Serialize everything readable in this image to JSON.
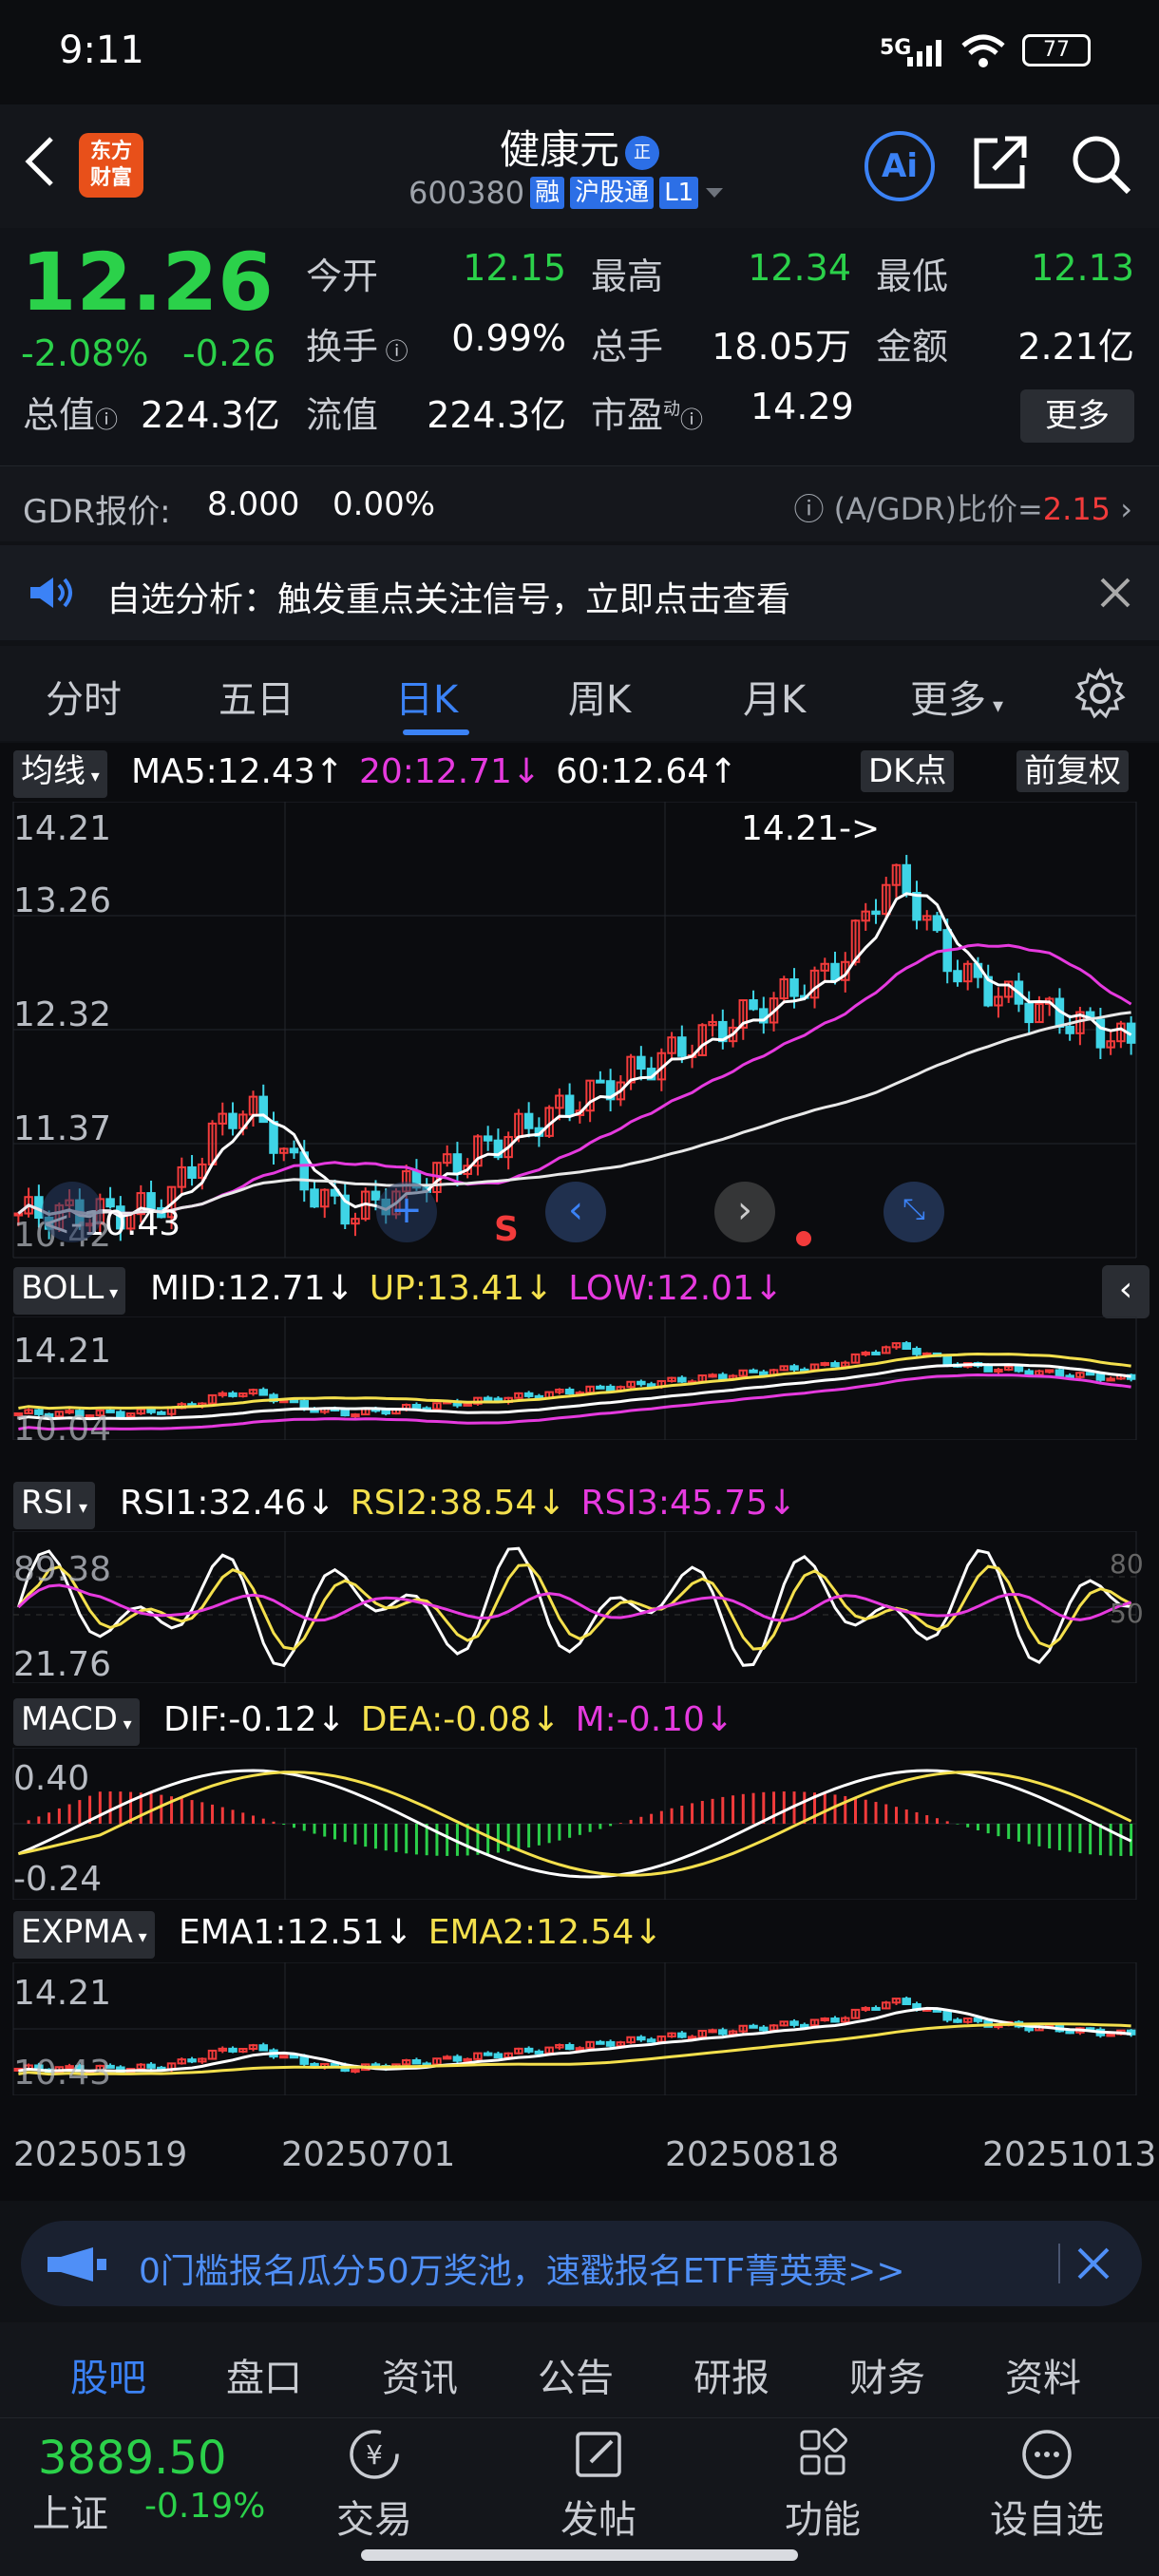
{
  "status_bar": {
    "time": "9:11",
    "signal": "5G",
    "battery": "77"
  },
  "header": {
    "logo_text": [
      "东方",
      "财富"
    ],
    "title": "健康元",
    "title_badge": "正",
    "code": "600380",
    "tags": [
      "融",
      "沪股通",
      "L1"
    ],
    "ai_label": "Ai"
  },
  "quote": {
    "price": "12.26",
    "change_pct": "-2.08%",
    "change_val": "-0.26",
    "fields": [
      {
        "label": "今开",
        "value": "12.15",
        "color": "#2bd14a"
      },
      {
        "label": "最高",
        "value": "12.34",
        "color": "#2bd14a"
      },
      {
        "label": "最低",
        "value": "12.13",
        "color": "#2bd14a"
      },
      {
        "label": "换手",
        "value": "0.99%",
        "color": "#ffffff"
      },
      {
        "label": "总手",
        "value": "18.05万",
        "color": "#ffffff"
      },
      {
        "label": "金额",
        "value": "2.21亿",
        "color": "#ffffff"
      },
      {
        "label": "总值",
        "value": "224.3亿",
        "color": "#ffffff"
      },
      {
        "label": "流值",
        "value": "224.3亿",
        "color": "#ffffff"
      },
      {
        "label": "市盈",
        "value": "14.29",
        "color": "#ffffff"
      }
    ],
    "pe_superscript": "动",
    "more_label": "更多"
  },
  "gdr": {
    "label": "GDR报价:",
    "price": "8.000",
    "pct": "0.00%",
    "ratio_label": "(A/GDR)比价=",
    "ratio": "2.15"
  },
  "notice": {
    "text": "自选分析：触发重点关注信号，立即点击查看"
  },
  "tabs": [
    "分时",
    "五日",
    "日K",
    "周K",
    "月K",
    "更多"
  ],
  "chart": {
    "ma_chip": "均线",
    "ma": [
      {
        "text": "MA5:12.43↑",
        "color": "#ffffff"
      },
      {
        "text": "20:12.71↓",
        "color": "#e63adf"
      },
      {
        "text": "60:12.64↑",
        "color": "#ffffff"
      }
    ],
    "dk_chip": "DK点",
    "adj_chip": "前复权",
    "main_axis": [
      "14.21",
      "13.26",
      "12.32",
      "11.37",
      "10.42"
    ],
    "high_marker": "14.21->",
    "low_marker": "<-10.43",
    "sell_marker": "S",
    "boll_chip": "BOLL",
    "boll": [
      {
        "text": "MID:12.71↓",
        "color": "#ffffff"
      },
      {
        "text": "UP:13.41↓",
        "color": "#f4e04d"
      },
      {
        "text": "LOW:12.01↓",
        "color": "#e63adf"
      }
    ],
    "boll_axis": [
      "14.21",
      "10.04"
    ],
    "rsi_chip": "RSI",
    "rsi": [
      {
        "text": "RSI1:32.46↓",
        "color": "#ffffff"
      },
      {
        "text": "RSI2:38.54↓",
        "color": "#f4e04d"
      },
      {
        "text": "RSI3:45.75↓",
        "color": "#e63adf"
      }
    ],
    "rsi_axis": [
      "89.38",
      "21.76"
    ],
    "rsi_ref": [
      "80",
      "50"
    ],
    "macd_chip": "MACD",
    "macd": [
      {
        "text": "DIF:-0.12↓",
        "color": "#ffffff"
      },
      {
        "text": "DEA:-0.08↓",
        "color": "#f4e04d"
      },
      {
        "text": "M:-0.10↓",
        "color": "#e63adf"
      }
    ],
    "macd_axis": [
      "0.40",
      "-0.24"
    ],
    "expma_chip": "EXPMA",
    "expma": [
      {
        "text": "EMA1:12.51↓",
        "color": "#ffffff"
      },
      {
        "text": "EMA2:12.54↓",
        "color": "#f4e04d"
      }
    ],
    "expma_axis": [
      "14.21",
      "10.43"
    ],
    "dates": [
      "20250519",
      "20250701",
      "20250818",
      "20251013"
    ]
  },
  "promo": {
    "text": "0门槛报名瓜分50万奖池，速戳报名ETF菁英赛>>"
  },
  "bottom_tabs": [
    "股吧",
    "盘口",
    "资讯",
    "公告",
    "研报",
    "财务",
    "资料"
  ],
  "bottom_nav": {
    "index_value": "3889.50",
    "index_name": "上证",
    "index_change": "-0.19%",
    "items": [
      {
        "label": "交易",
        "icon": "yuan-icon"
      },
      {
        "label": "发帖",
        "icon": "edit-icon"
      },
      {
        "label": "功能",
        "icon": "grid-icon"
      },
      {
        "label": "设自选",
        "icon": "more-dots-icon"
      }
    ]
  }
}
